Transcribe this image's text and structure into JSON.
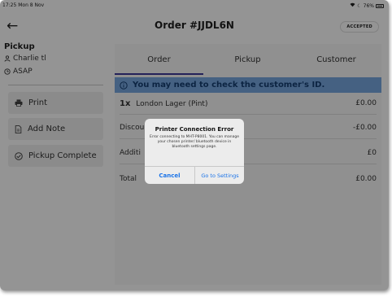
{
  "status_bar": {
    "time": "17:25",
    "date": "Mon 8 Nov",
    "wifi_icon": "wifi-icon",
    "moon_icon": "moon-icon",
    "battery": "76%"
  },
  "header": {
    "back_icon": "back-arrow-icon",
    "title": "Order #JJDL6N",
    "status_badge": "ACCEPTED"
  },
  "left": {
    "heading": "Pickup",
    "customer": "Charlie tl",
    "time": "ASAP",
    "buttons": [
      {
        "label": "Print",
        "icon": "printer-icon"
      },
      {
        "label": "Add Note",
        "icon": "note-icon"
      },
      {
        "label": "Pickup Complete",
        "icon": "check-circle-icon"
      }
    ]
  },
  "tabs": [
    {
      "label": "Order",
      "active": true
    },
    {
      "label": "Pickup",
      "active": false
    },
    {
      "label": "Customer",
      "active": false
    }
  ],
  "alert": {
    "icon": "info-icon",
    "text": "You may need to check the customer's ID."
  },
  "order": {
    "item": {
      "qty": "1x",
      "name": "London Lager (Pint)",
      "price": "£0.00"
    },
    "discount": {
      "label": "Discou",
      "value": "-£0.00"
    },
    "additional": {
      "label": "Additi",
      "value": "£0"
    },
    "total": {
      "label": "Total",
      "value": "£0.00"
    }
  },
  "dialog": {
    "title": "Printer Connection Error",
    "message": "Error connecting to MHT-P8001. You can manage your chosen printer/ bluetooth device in bluetooth settings page.",
    "cancel": "Cancel",
    "settings": "Go to Settings"
  },
  "colors": {
    "accent": "#3e3a9a",
    "alert_bg": "#78a8e0",
    "alert_text": "#163f73",
    "dialog_button": "#1a73e8"
  }
}
